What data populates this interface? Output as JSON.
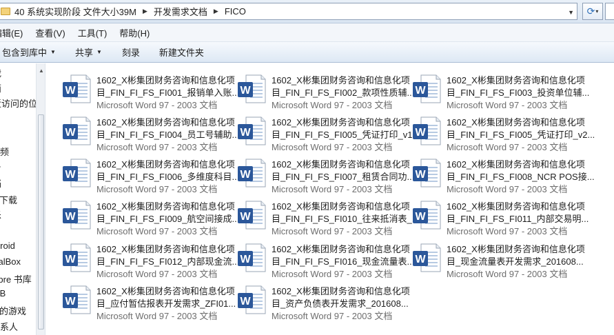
{
  "address": {
    "crumbs": [
      "40 系统实现阶段 文件大小39M",
      "开发需求文档",
      "FICO"
    ]
  },
  "menu": [
    "编辑(E)",
    "查看(V)",
    "工具(T)",
    "帮助(H)"
  ],
  "toolbar": {
    "include_library": "包含到库中",
    "share": "共享",
    "burn": "刻录",
    "new_folder": "新建文件夹"
  },
  "nav": {
    "items": [
      "载",
      "面",
      "近访问的位置",
      "",
      "视频",
      "片",
      "档",
      "迅雷下载",
      "乐",
      "Android",
      "VirtualBox",
      "Calibre 书库",
      "Ⅲ B",
      "保存的游戏",
      "联系人"
    ]
  },
  "file_type": "Microsoft Word 97 - 2003 文档",
  "files": [
    {
      "l1": "1602_X彬集团财务咨询和信息化项",
      "l2": "目_FIN_FI_FS_FI001_报销单入账..."
    },
    {
      "l1": "1602_X彬集团财务咨询和信息化项",
      "l2": "目_FIN_FI_FS_FI002_款项性质辅..."
    },
    {
      "l1": "1602_X彬集团财务咨询和信息化项",
      "l2": "目_FIN_FI_FS_FI003_投资单位辅..."
    },
    {
      "l1": "1602_X彬集团财务咨询和信息化项",
      "l2": "目_FIN_FI_FS_FI004_员工号辅助..."
    },
    {
      "l1": "1602_X彬集团财务咨询和信息化项",
      "l2": "目_FIN_FI_FS_FI005_凭证打印_v1..."
    },
    {
      "l1": "1602_X彬集团财务咨询和信息化项",
      "l2": "目_FIN_FI_FS_FI005_凭证打印_v2..."
    },
    {
      "l1": "1602_X彬集团财务咨询和信息化项",
      "l2": "目_FIN_FI_FS_FI006_多维度科目..."
    },
    {
      "l1": "1602_X彬集团财务咨询和信息化项",
      "l2": "目_FIN_FI_FS_FI007_租赁合同功..."
    },
    {
      "l1": "1602_X彬集团财务咨询和信息化项",
      "l2": "目_FIN_FI_FS_FI008_NCR POS接..."
    },
    {
      "l1": "1602_X彬集团财务咨询和信息化项",
      "l2": "目_FIN_FI_FS_FI009_航空间接成..."
    },
    {
      "l1": "1602_X彬集团财务咨询和信息化项",
      "l2": "目_FIN_FI_FS_FI010_往来抵消表_..."
    },
    {
      "l1": "1602_X彬集团财务咨询和信息化项",
      "l2": "目_FIN_FI_FS_FI011_内部交易明..."
    },
    {
      "l1": "1602_X彬集团财务咨询和信息化项",
      "l2": "目_FIN_FI_FS_FI012_内部现金流..."
    },
    {
      "l1": "1602_X彬集团财务咨询和信息化项",
      "l2": "目_FIN_FI_FS_FI016_现金流量表..."
    },
    {
      "l1": "1602_X彬集团财务咨询和信息化项",
      "l2": "目_现金流量表开发需求_201608..."
    },
    {
      "l1": "1602_X彬集团财务咨询和信息化项",
      "l2": "目_应付暂估报表开发需求_ZFI01..."
    },
    {
      "l1": "1602_X彬集团财务咨询和信息化项",
      "l2": "目_资产负债表开发需求_201608..."
    }
  ],
  "colors": {
    "word_blue": "#2b579a",
    "type_gray": "#6d6d6d"
  },
  "icons": {
    "refresh": "refresh-icon",
    "folder": "folder-icon",
    "doc": "word-doc-icon"
  }
}
